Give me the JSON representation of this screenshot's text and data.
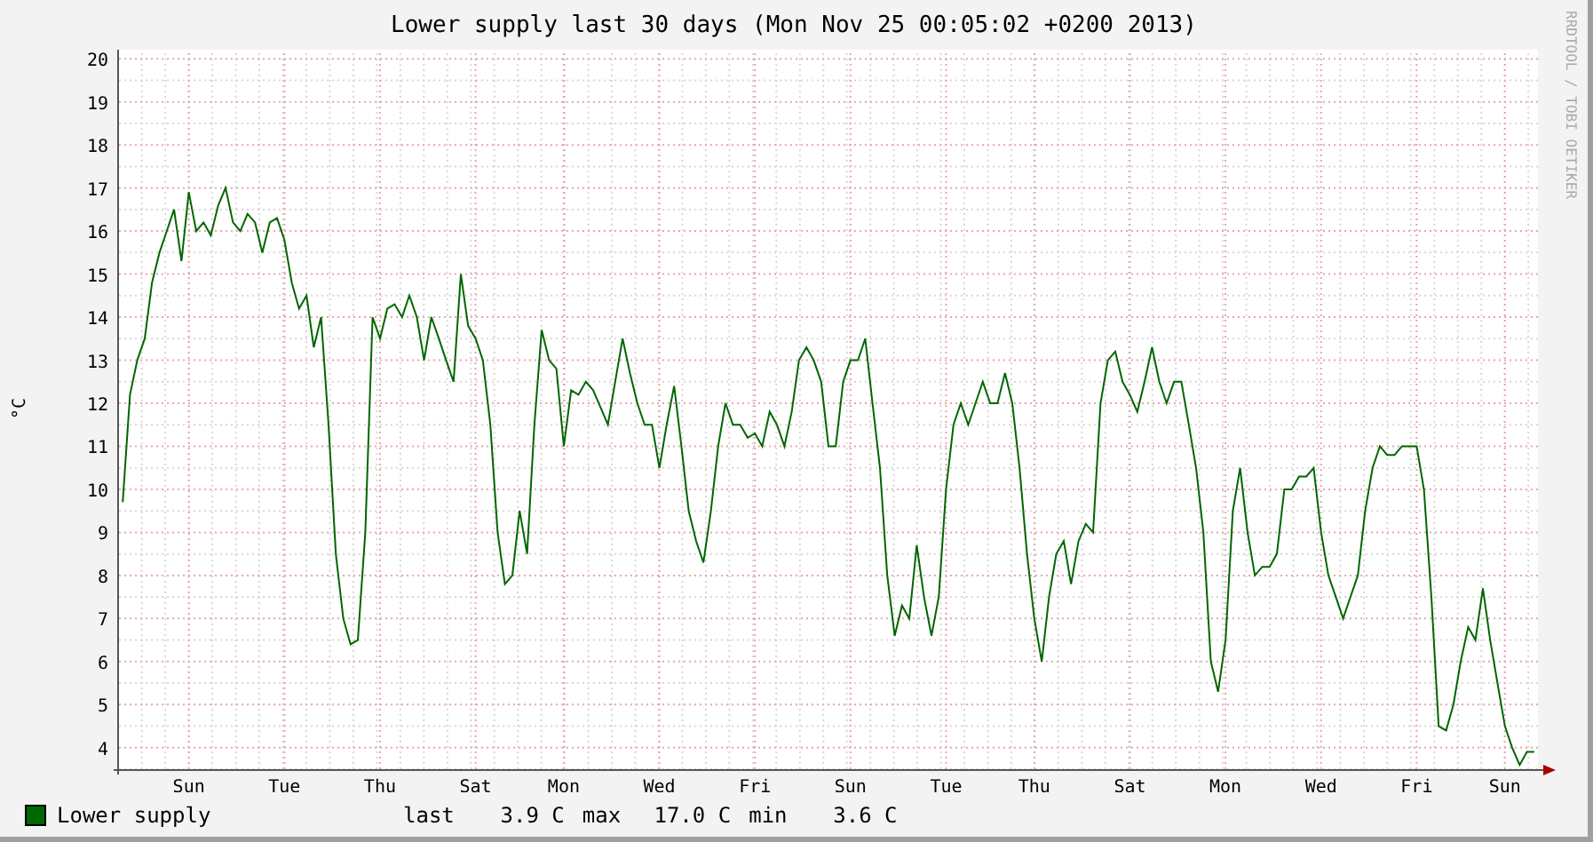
{
  "title": "Lower supply last 30 days (Mon Nov 25 00:05:02 +0200 2013)",
  "watermark_side": "RRDTOOL / TOBI OETIKER",
  "chart_data": {
    "type": "line",
    "ylabel": "°C",
    "ylim": [
      3.5,
      20.5
    ],
    "grid": true,
    "yticks": [
      4,
      5,
      6,
      7,
      8,
      9,
      10,
      11,
      12,
      13,
      14,
      15,
      16,
      17,
      18,
      19,
      20
    ],
    "categories": [
      null,
      null,
      null,
      null,
      null,
      null,
      null,
      null,
      null,
      "Sun",
      null,
      null,
      null,
      null,
      null,
      null,
      null,
      null,
      null,
      null,
      null,
      null,
      "Tue",
      null,
      null,
      null,
      null,
      null,
      null,
      null,
      null,
      null,
      null,
      null,
      null,
      "Thu",
      null,
      null,
      null,
      null,
      null,
      null,
      null,
      null,
      null,
      null,
      null,
      null,
      "Sat",
      null,
      null,
      null,
      null,
      null,
      null,
      null,
      null,
      null,
      null,
      null,
      "Mon",
      null,
      null,
      null,
      null,
      null,
      null,
      null,
      null,
      null,
      null,
      null,
      null,
      "Wed",
      null,
      null,
      null,
      null,
      null,
      null,
      null,
      null,
      null,
      null,
      null,
      null,
      "Fri",
      null,
      null,
      null,
      null,
      null,
      null,
      null,
      null,
      null,
      null,
      null,
      null,
      "Sun",
      null,
      null,
      null,
      null,
      null,
      null,
      null,
      null,
      null,
      null,
      null,
      null,
      "Tue",
      null,
      null,
      null,
      null,
      null,
      null,
      null,
      null,
      null,
      null,
      null,
      "Thu",
      null,
      null,
      null,
      null,
      null,
      null,
      null,
      null,
      null,
      null,
      null,
      null,
      "Sat",
      null,
      null,
      null,
      null,
      null,
      null,
      null,
      null,
      null,
      null,
      null,
      null,
      "Mon",
      null,
      null,
      null,
      null,
      null,
      null,
      null,
      null,
      null,
      null,
      null,
      null,
      "Wed",
      null,
      null,
      null,
      null,
      null,
      null,
      null,
      null,
      null,
      null,
      null,
      null,
      "Fri",
      null,
      null,
      null,
      null,
      null,
      null,
      null,
      null,
      null,
      null,
      null,
      "Sun",
      null,
      null,
      null,
      null
    ],
    "series": [
      {
        "name": "Lower supply",
        "color": "#006600",
        "values": [
          9.7,
          12.2,
          13.0,
          13.5,
          14.8,
          15.5,
          16.0,
          16.5,
          15.3,
          16.9,
          16.0,
          16.2,
          15.9,
          16.6,
          17.0,
          16.2,
          16.0,
          16.4,
          16.2,
          15.5,
          16.2,
          16.3,
          15.8,
          14.8,
          14.2,
          14.5,
          13.3,
          14.0,
          11.5,
          8.5,
          7.0,
          6.4,
          6.5,
          9.0,
          14.0,
          13.5,
          14.2,
          14.3,
          14.0,
          14.5,
          14.0,
          13.0,
          14.0,
          13.5,
          13.0,
          12.5,
          15.0,
          13.8,
          13.5,
          13.0,
          11.5,
          9.0,
          7.8,
          8.0,
          9.5,
          8.5,
          11.5,
          13.7,
          13.0,
          12.8,
          11.0,
          12.3,
          12.2,
          12.5,
          12.3,
          11.9,
          11.5,
          12.5,
          13.5,
          12.7,
          12.0,
          11.5,
          11.5,
          10.5,
          11.5,
          12.4,
          11.0,
          9.5,
          8.8,
          8.3,
          9.5,
          11.0,
          12.0,
          11.5,
          11.5,
          11.2,
          11.3,
          11.0,
          11.8,
          11.5,
          11.0,
          11.8,
          13.0,
          13.3,
          13.0,
          12.5,
          11.0,
          11.0,
          12.5,
          13.0,
          13.0,
          13.5,
          12.0,
          10.5,
          8.0,
          6.6,
          7.3,
          7.0,
          8.7,
          7.5,
          6.6,
          7.5,
          10.0,
          11.5,
          12.0,
          11.5,
          12.0,
          12.5,
          12.0,
          12.0,
          12.7,
          12.0,
          10.5,
          8.5,
          7.0,
          6.0,
          7.5,
          8.5,
          8.8,
          7.8,
          8.8,
          9.2,
          9.0,
          12.0,
          13.0,
          13.2,
          12.5,
          12.2,
          11.8,
          12.5,
          13.3,
          12.5,
          12.0,
          12.5,
          12.5,
          11.5,
          10.5,
          9.0,
          6.0,
          5.3,
          6.5,
          9.5,
          10.5,
          9.0,
          8.0,
          8.2,
          8.2,
          8.5,
          10.0,
          10.0,
          10.3,
          10.3,
          10.5,
          9.0,
          8.0,
          7.5,
          7.0,
          7.5,
          8.0,
          9.5,
          10.5,
          11.0,
          10.8,
          10.8,
          11.0,
          11.0,
          11.0,
          10.0,
          7.5,
          4.5,
          4.4,
          5.0,
          6.0,
          6.8,
          6.5,
          7.7,
          6.5,
          5.5,
          4.5,
          4.0,
          3.6,
          3.9,
          3.9
        ]
      }
    ]
  },
  "legend": {
    "stats": [
      {
        "label": "last",
        "value": "3.9 C"
      },
      {
        "label": "max",
        "value": "17.0 C"
      },
      {
        "label": "min",
        "value": "3.6 C"
      }
    ]
  }
}
